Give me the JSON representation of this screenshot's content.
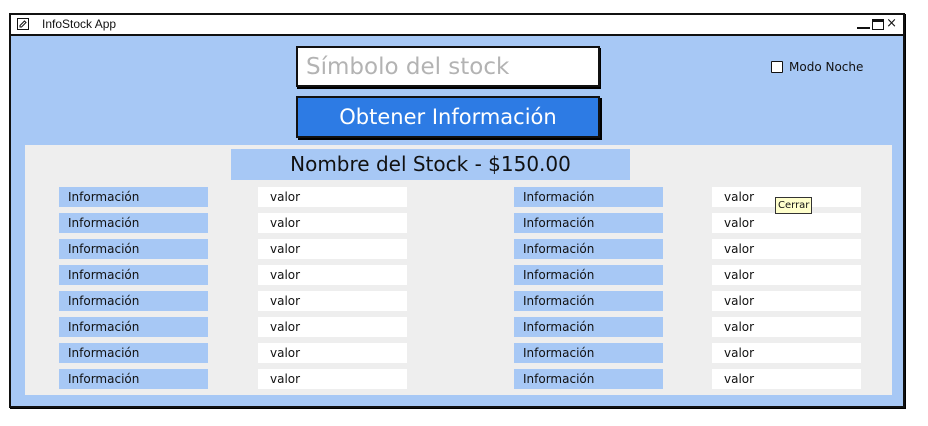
{
  "window": {
    "title": "InfoStock App",
    "close_glyph": "×"
  },
  "search": {
    "placeholder": "Símbolo del stock",
    "value": ""
  },
  "actions": {
    "get_info_label": "Obtener Información"
  },
  "settings": {
    "night_mode_label": "Modo Noche",
    "night_mode_checked": false
  },
  "stock": {
    "header": "Nombre del Stock - $150.00"
  },
  "info_left": [
    {
      "label": "Información",
      "value": "valor"
    },
    {
      "label": "Información",
      "value": "valor"
    },
    {
      "label": "Información",
      "value": "valor"
    },
    {
      "label": "Información",
      "value": "valor"
    },
    {
      "label": "Información",
      "value": "valor"
    },
    {
      "label": "Información",
      "value": "valor"
    },
    {
      "label": "Información",
      "value": "valor"
    },
    {
      "label": "Información",
      "value": "valor"
    }
  ],
  "info_right": [
    {
      "label": "Información",
      "value": "valor"
    },
    {
      "label": "Información",
      "value": "valor"
    },
    {
      "label": "Información",
      "value": "valor"
    },
    {
      "label": "Información",
      "value": "valor"
    },
    {
      "label": "Información",
      "value": "valor"
    },
    {
      "label": "Información",
      "value": "valor"
    },
    {
      "label": "Información",
      "value": "valor"
    },
    {
      "label": "Información",
      "value": "valor"
    }
  ],
  "tooltip": {
    "text": "Cerrar"
  },
  "colors": {
    "window_bg": "#a7c8f5",
    "button_bg": "#2d7be4",
    "panel_bg": "#eeeeee"
  }
}
